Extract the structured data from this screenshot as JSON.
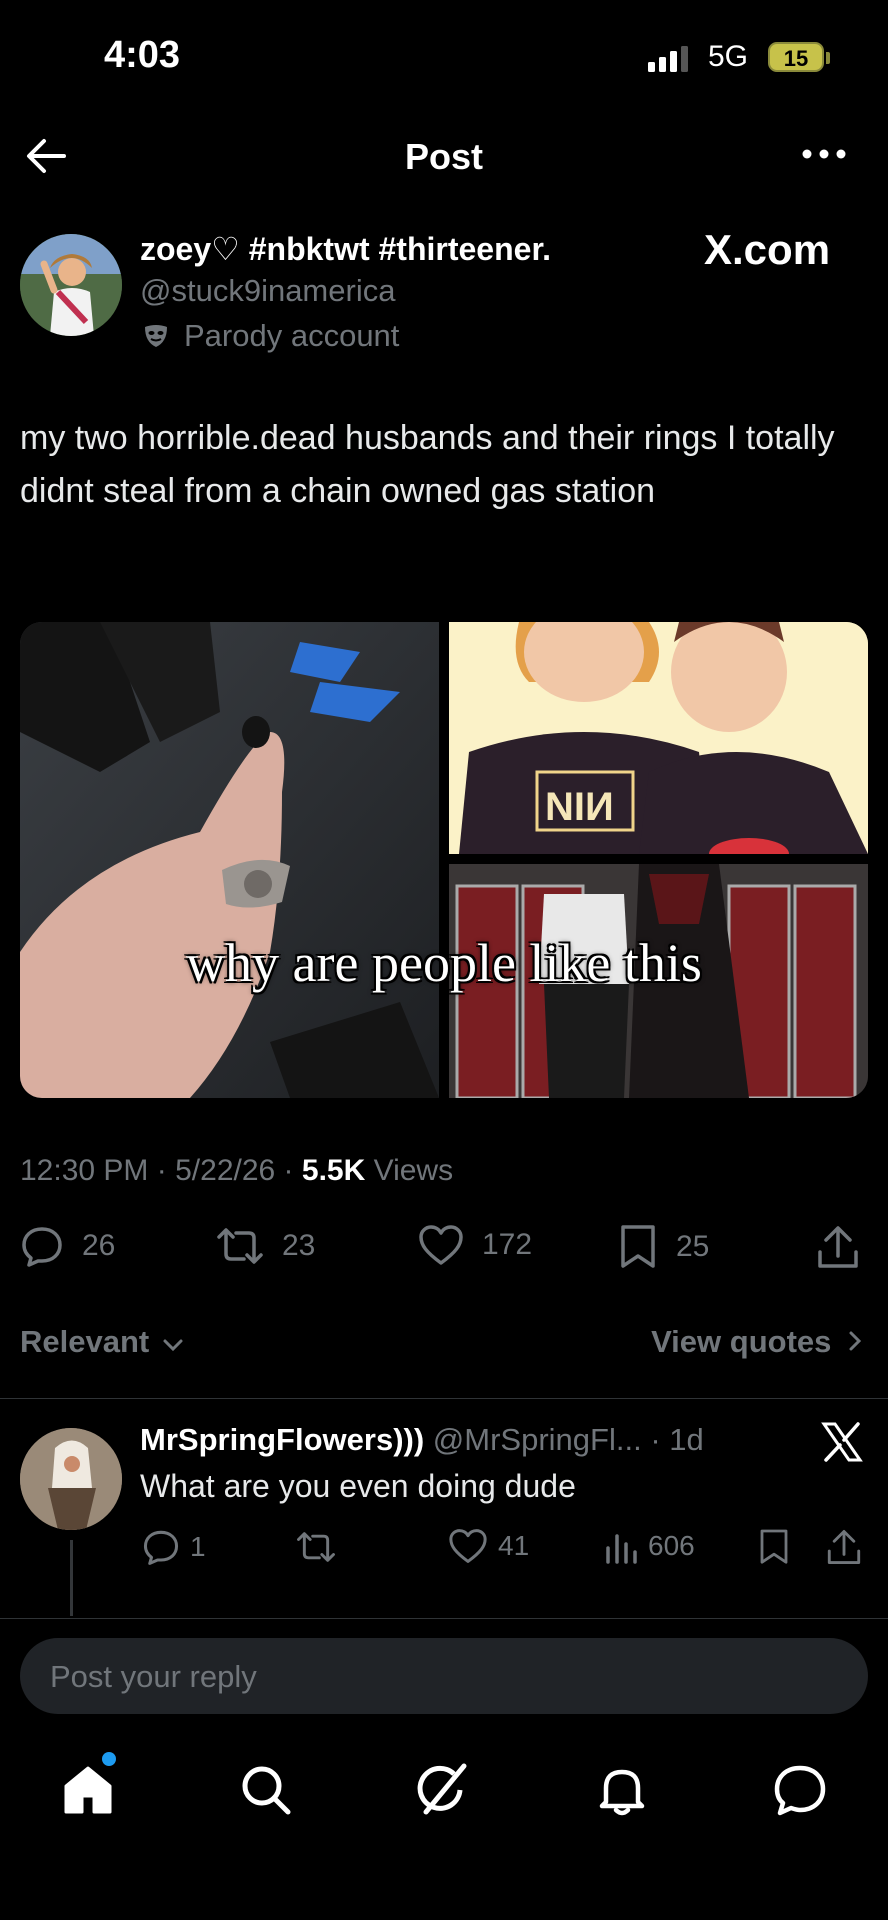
{
  "status_bar": {
    "time": "4:03",
    "network": "5G",
    "battery": "15"
  },
  "header": {
    "title": "Post"
  },
  "post": {
    "display_name": "zoey♡ #nbktwt #thirteener.",
    "handle": "@stuck9inamerica",
    "label": "Parody account",
    "watermark": "X.com",
    "text": "my two horrible.dead husbands and their rings I totally didnt steal from a chain owned gas station",
    "media_caption": "why are people like this",
    "time": "12:30 PM",
    "date": "5/22/26",
    "views": "5.5K",
    "views_label": "Views",
    "meta_sep": "·",
    "stats": {
      "replies": "26",
      "reposts": "23",
      "likes": "172",
      "bookmarks": "25"
    }
  },
  "sort": {
    "label": "Relevant",
    "view_quotes": "View quotes"
  },
  "reply": {
    "name": "MrSpringFlowers)))",
    "handle": "@MrSpringFl...",
    "age": "1d",
    "text": "What are you even doing dude",
    "stats": {
      "replies": "1",
      "likes": "41",
      "views": "606"
    }
  },
  "composer": {
    "placeholder": "Post your reply"
  },
  "nav": [
    "home-icon",
    "search-icon",
    "grok-icon",
    "notifications-icon",
    "messages-icon"
  ],
  "colors": {
    "background": "#000000",
    "muted": "#71767b",
    "accent": "#1d9bf0",
    "text": "#e7e9ea"
  }
}
